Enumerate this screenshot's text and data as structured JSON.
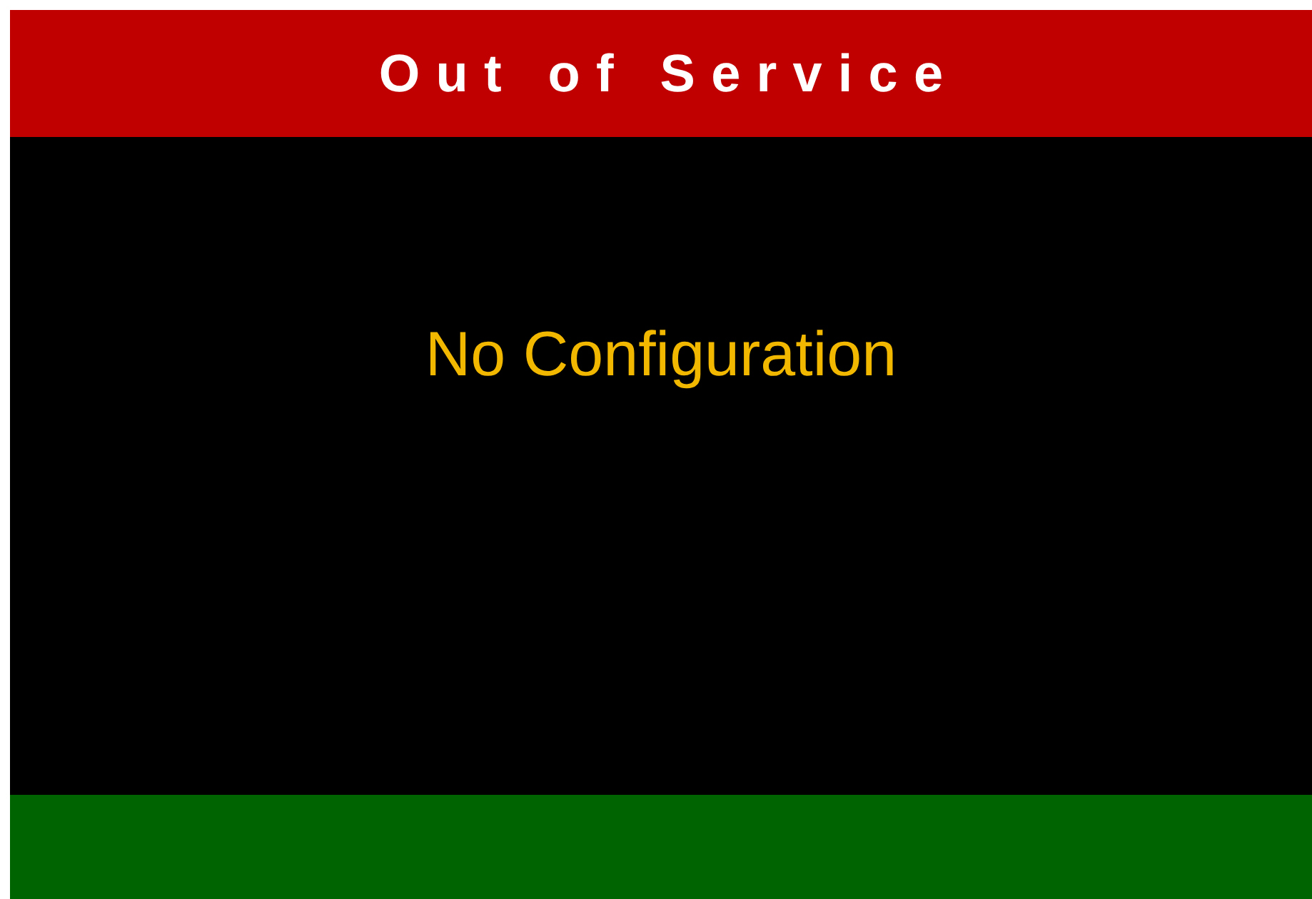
{
  "header": {
    "title": "Out of Service"
  },
  "message": "No Configuration"
}
